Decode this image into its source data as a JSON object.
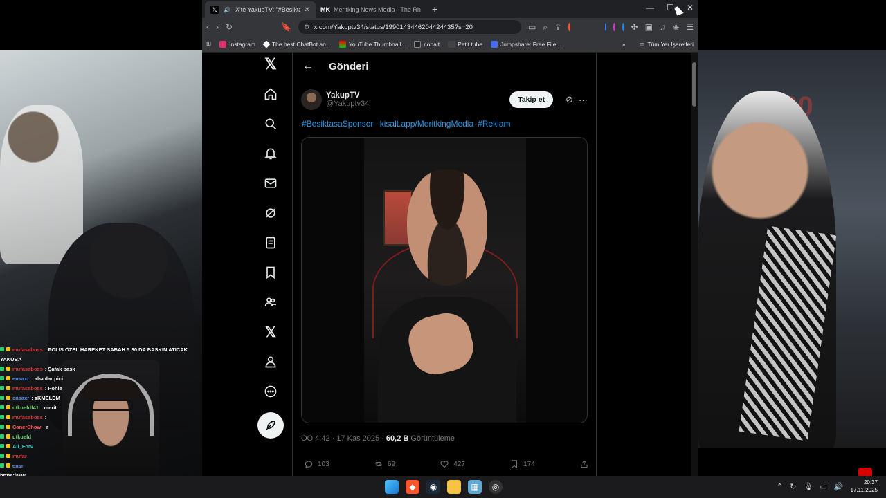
{
  "browser": {
    "tabs": [
      {
        "label": "X'te YakupTV: \"#BesiktasaSpo",
        "active": true,
        "icon": "x-logo-icon"
      },
      {
        "label": "Meritking News Media - The Rhythm",
        "active": false,
        "icon": "mk-logo-icon"
      }
    ],
    "new_tab": "+",
    "url": "x.com/Yakuptv34/status/1990143446204424435?s=20",
    "bookmarks": [
      {
        "label": "Instagram",
        "color": "#e1306c"
      },
      {
        "label": "The best ChatBot an...",
        "color": "#ffffff"
      },
      {
        "label": "YouTube Thumbnail...",
        "color": "#ff0000"
      },
      {
        "label": "cobalt",
        "color": "#222222"
      },
      {
        "label": "Petit tube",
        "color": "#333333"
      },
      {
        "label": "Jumpshare: Free File...",
        "color": "#4a6cf7"
      }
    ],
    "all_bookmarks": "Tüm Yer İşaretleri"
  },
  "page": {
    "header_title": "Gönderi",
    "author": {
      "display_name": "YakupTV",
      "username": "@Yakuptv34"
    },
    "follow_label": "Takip et",
    "tweet_links": [
      "#BesiktasaSponsor",
      "kisalt.app/MeritkingMedia",
      "#Reklam"
    ],
    "time": "ÖÖ 4:42",
    "date": "17 Kas 2025",
    "views": "60,2 B",
    "views_label": "Görüntüleme",
    "replies": "103",
    "retweets": "69",
    "likes": "427",
    "bookmarks": "174",
    "nav_items": [
      "x-logo-icon",
      "home-icon",
      "search-icon",
      "bell-icon",
      "mail-icon",
      "grok-icon",
      "lists-icon",
      "bookmark-icon",
      "communities-icon",
      "premium-icon",
      "profile-icon",
      "more-icon"
    ]
  },
  "chat": {
    "lines": [
      {
        "user": "mufasaboss",
        "msg": ": POLIS ÖZEL HAREKET SABAH 5:30 DA BASKIN ATICAK",
        "color": "#d63b3b"
      },
      {
        "user": "",
        "msg": "YAKUBA",
        "color": "#ffffff"
      },
      {
        "user": "mufasaboss",
        "msg": ": Şafak bask",
        "color": "#d63b3b"
      },
      {
        "user": "ensaxr",
        "msg": ": alsınlar pici",
        "color": "#5b8def"
      },
      {
        "user": "mufasaboss",
        "msg": ": Pöhle",
        "color": "#d63b3b"
      },
      {
        "user": "ensaxr",
        "msg": ": əKMELDM",
        "color": "#5b8def"
      },
      {
        "user": "utkuefdf41",
        "msg": ": merit",
        "color": "#7cd67c"
      },
      {
        "user": "mufasaboss",
        "msg": ":",
        "color": "#d63b3b"
      },
      {
        "user": "CanerShow",
        "msg": ": r",
        "color": "#ff5a5a"
      },
      {
        "user": "utkuefd",
        "msg": "",
        "color": "#7cd67c"
      },
      {
        "user": "Ali_Forv",
        "msg": "",
        "color": "#41c7c7"
      },
      {
        "user": "mufar",
        "msg": "",
        "color": "#d63b3b"
      },
      {
        "user": "ensr",
        "msg": "",
        "color": "#5b8def"
      },
      {
        "user": "",
        "msg": "https://ww",
        "color": "#ffffff"
      }
    ]
  },
  "taskbar": {
    "time": "20:37",
    "date": "17.11.2025"
  }
}
